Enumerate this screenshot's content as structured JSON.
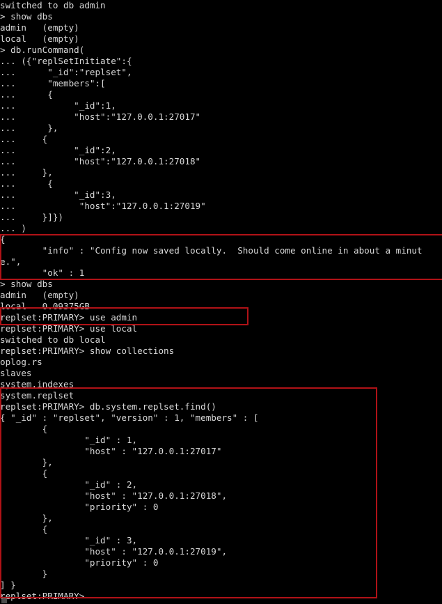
{
  "terminal": {
    "background_color": "#000000",
    "text_color": "#d8d8d8",
    "annotation_color": "#b01217",
    "prompt_primary": "> ",
    "prompt_continuation": "... ",
    "prompt_replset": "replset:PRIMARY> ",
    "lines": [
      "switched to db admin",
      "> show dbs",
      "admin   (empty)",
      "local   (empty)",
      "> db.runCommand(",
      "... ({\"replSetInitiate\":{",
      "...      \"_id\":\"replset\",",
      "...      \"members\":[",
      "...      {",
      "...           \"_id\":1,",
      "...           \"host\":\"127.0.0.1:27017\"",
      "...      },",
      "...     {",
      "...           \"_id\":2,",
      "...           \"host\":\"127.0.0.1:27018\"",
      "...     },",
      "...      {",
      "...           \"_id\":3,",
      "...            \"host\":\"127.0.0.1:27019\"",
      "...     }]})",
      "... )",
      "{",
      "        \"info\" : \"Config now saved locally.  Should come online in about a minut",
      "e.\",",
      "        \"ok\" : 1",
      "> show dbs",
      "admin   (empty)",
      "local   0.09375GB",
      "replset:PRIMARY> use admin",
      "replset:PRIMARY> use local",
      "switched to db local",
      "replset:PRIMARY> show collections",
      "oplog.rs",
      "slaves",
      "system.indexes",
      "system.replset",
      "replset:PRIMARY> db.system.replset.find()",
      "{ \"_id\" : \"replset\", \"version\" : 1, \"members\" : [",
      "        {",
      "                \"_id\" : 1,",
      "                \"host\" : \"127.0.0.1:27017\"",
      "        },",
      "        {",
      "                \"_id\" : 2,",
      "                \"host\" : \"127.0.0.1:27018\",",
      "                \"priority\" : 0",
      "        },",
      "        {",
      "                \"_id\" : 3,",
      "                \"host\" : \"127.0.0.1:27019\",",
      "                \"priority\" : 0",
      "        }",
      "] }",
      "replset:PRIMARY>"
    ]
  },
  "annotations": [
    {
      "id": "annot-box-1",
      "label": "replSetInitiate-response-highlight",
      "covers": "{ \"info\" : \"Config now saved locally.  Should come online in about a minute.\", \"ok\" : 1"
    },
    {
      "id": "annot-box-2",
      "label": "use-admin-command-highlight",
      "covers": "replset:PRIMARY> use admin"
    },
    {
      "id": "annot-box-3",
      "label": "system-replset-find-output-highlight",
      "covers": "system.replset / db.system.replset.find() output"
    }
  ]
}
